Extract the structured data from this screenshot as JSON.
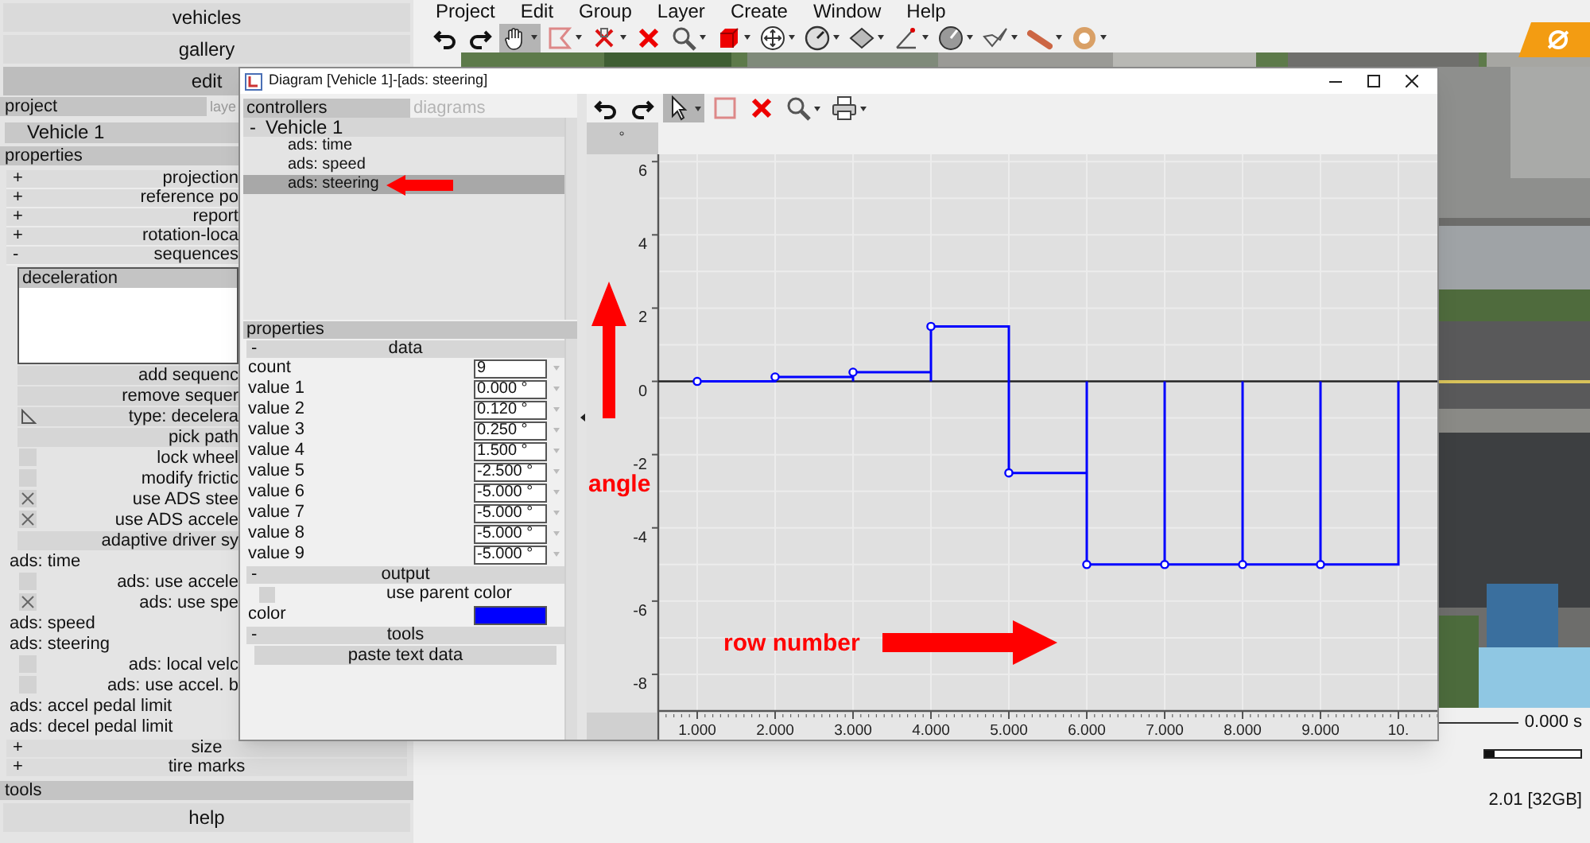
{
  "nav": [
    {
      "label": "vehicles",
      "selected": false
    },
    {
      "label": "gallery",
      "selected": false
    },
    {
      "label": "edit",
      "selected": true
    }
  ],
  "panel_tabs": [
    {
      "label": "project",
      "selected": true
    },
    {
      "label": "laye",
      "selected": false
    }
  ],
  "vehicle_list": [
    {
      "label": "Vehicle 1",
      "selected": true
    }
  ],
  "properties": {
    "title": "properties",
    "rows": [
      {
        "kind": "section",
        "toggle": "+",
        "label": "projection"
      },
      {
        "kind": "section",
        "toggle": "+",
        "label": "reference po"
      },
      {
        "kind": "section",
        "toggle": "+",
        "label": "report"
      },
      {
        "kind": "section",
        "toggle": "+",
        "label": "rotation-loca"
      },
      {
        "kind": "section",
        "toggle": "-",
        "label": "sequences"
      },
      {
        "kind": "list",
        "label": "deceleration"
      },
      {
        "kind": "button",
        "label": "add sequenc"
      },
      {
        "kind": "button",
        "label": "remove sequer"
      },
      {
        "kind": "icon-button",
        "label": "type: decelera"
      },
      {
        "kind": "button",
        "label": "pick path"
      },
      {
        "kind": "checkbox",
        "label": "lock wheel",
        "checked": false
      },
      {
        "kind": "checkbox",
        "label": "modify frictic",
        "checked": false
      },
      {
        "kind": "checkbox",
        "label": "use ADS stee",
        "checked": true
      },
      {
        "kind": "checkbox",
        "label": "use ADS accele",
        "checked": true
      },
      {
        "kind": "button",
        "label": "adaptive driver sy"
      },
      {
        "kind": "label",
        "label": "ads: time"
      },
      {
        "kind": "checkbox",
        "label": "ads: use accele",
        "checked": false
      },
      {
        "kind": "checkbox",
        "label": "ads: use spe",
        "checked": true
      },
      {
        "kind": "label",
        "label": "ads: speed"
      },
      {
        "kind": "label",
        "label": "ads: steering"
      },
      {
        "kind": "checkbox",
        "label": "ads: local velc",
        "checked": false
      },
      {
        "kind": "checkbox",
        "label": "ads: use accel. b",
        "checked": false
      },
      {
        "kind": "label",
        "label": "ads: accel pedal limit"
      },
      {
        "kind": "label",
        "label": "ads: decel pedal limit"
      }
    ],
    "more_rows": [
      {
        "toggle": "+",
        "label": "size"
      },
      {
        "toggle": "+",
        "label": "tire marks"
      }
    ]
  },
  "tools": {
    "title": "tools",
    "button": "help"
  },
  "menu": [
    "Project",
    "Edit",
    "Group",
    "Layer",
    "Create",
    "Window",
    "Help"
  ],
  "main_toolbar": [
    {
      "kind": "undo",
      "selected": false,
      "dropdown": false
    },
    {
      "kind": "redo",
      "selected": false,
      "dropdown": false
    },
    {
      "kind": "hand",
      "selected": true,
      "dropdown": true
    },
    {
      "kind": "select-shape",
      "selected": false,
      "dropdown": true
    },
    {
      "kind": "cut-x",
      "selected": false,
      "dropdown": true
    },
    {
      "kind": "delete",
      "selected": false,
      "dropdown": false
    },
    {
      "kind": "zoom",
      "selected": false,
      "dropdown": true
    },
    {
      "kind": "cube",
      "selected": false,
      "dropdown": true
    },
    {
      "kind": "move",
      "selected": false,
      "dropdown": true
    },
    {
      "kind": "gauge",
      "selected": false,
      "dropdown": true
    },
    {
      "kind": "plate",
      "selected": false,
      "dropdown": true
    },
    {
      "kind": "angle",
      "selected": false,
      "dropdown": true
    },
    {
      "kind": "dial",
      "selected": false,
      "dropdown": true
    },
    {
      "kind": "check",
      "selected": false,
      "dropdown": true
    },
    {
      "kind": "stick",
      "selected": false,
      "dropdown": true
    },
    {
      "kind": "orb",
      "selected": false,
      "dropdown": true
    }
  ],
  "status": {
    "time": "0.000 s",
    "timeline": {
      "level": 0
    },
    "version": "2.01 [32GB]"
  },
  "dialog": {
    "title": "Diagram [Vehicle 1]-[ads: steering]",
    "tabs": [
      {
        "label": "controllers",
        "selected": true
      },
      {
        "label": "diagrams",
        "selected": false
      }
    ],
    "tree": [
      {
        "toggle": "-",
        "label": "Vehicle 1",
        "selected": false,
        "children": [
          {
            "label": "ads: time",
            "selected": false
          },
          {
            "label": "ads: speed",
            "selected": false
          },
          {
            "label": "ads: steering",
            "selected": true
          }
        ]
      }
    ],
    "properties": {
      "title": "properties",
      "sections": [
        {
          "toggle": "-",
          "title": "data",
          "rows": [
            {
              "kind": "field",
              "label": "count",
              "value": "9"
            },
            {
              "kind": "field",
              "label": "value 1",
              "value": "0.000 °"
            },
            {
              "kind": "field",
              "label": "value 2",
              "value": "0.120 °"
            },
            {
              "kind": "field",
              "label": "value 3",
              "value": "0.250 °"
            },
            {
              "kind": "field",
              "label": "value 4",
              "value": "1.500 °"
            },
            {
              "kind": "field",
              "label": "value 5",
              "value": "-2.500 °"
            },
            {
              "kind": "field",
              "label": "value 6",
              "value": "-5.000 °"
            },
            {
              "kind": "field",
              "label": "value 7",
              "value": "-5.000 °"
            },
            {
              "kind": "field",
              "label": "value 8",
              "value": "-5.000 °"
            },
            {
              "kind": "field",
              "label": "value 9",
              "value": "-5.000 °"
            }
          ]
        },
        {
          "toggle": "-",
          "title": "output",
          "rows": [
            {
              "kind": "checkbox",
              "label": "use parent color",
              "checked": false
            },
            {
              "kind": "color",
              "label": "color",
              "color": "#0000ff"
            }
          ]
        },
        {
          "toggle": "-",
          "title": "tools",
          "rows": [
            {
              "kind": "button",
              "label": "paste text data"
            }
          ]
        }
      ]
    },
    "toolbar": [
      {
        "kind": "undo",
        "selected": false,
        "dropdown": false
      },
      {
        "kind": "redo",
        "selected": false,
        "dropdown": false
      },
      {
        "kind": "pointer",
        "selected": true,
        "dropdown": true
      },
      {
        "kind": "rect",
        "selected": false,
        "dropdown": false
      },
      {
        "kind": "delete",
        "selected": false,
        "dropdown": false
      },
      {
        "kind": "zoom",
        "selected": false,
        "dropdown": true
      },
      {
        "kind": "print",
        "selected": false,
        "dropdown": true
      }
    ],
    "y_unit": "°",
    "chart_data": {
      "type": "line",
      "x": [
        1,
        2,
        2,
        3,
        3,
        3,
        4,
        4,
        4,
        5,
        5,
        5,
        6,
        6,
        6,
        7,
        7,
        7,
        8,
        8,
        8,
        9,
        9,
        9,
        10,
        10
      ],
      "series": [
        {
          "color": "#0000ff",
          "values": [
            0,
            0,
            0.12,
            0.12,
            0,
            0.25,
            0.25,
            0,
            1.5,
            1.5,
            0,
            -2.5,
            -2.5,
            0,
            -5,
            -5,
            0,
            -5,
            -5,
            0,
            -5,
            -5,
            0,
            -5,
            -5,
            0
          ]
        }
      ],
      "xlim": [
        0.5,
        10.5
      ],
      "ylim": [
        -9,
        6.2
      ],
      "xticks": [
        {
          "value": 1,
          "label": "1.000"
        },
        {
          "value": 2,
          "label": "2.000"
        },
        {
          "value": 3,
          "label": "3.000"
        },
        {
          "value": 4,
          "label": "4.000"
        },
        {
          "value": 5,
          "label": "5.000"
        },
        {
          "value": 6,
          "label": "6.000"
        },
        {
          "value": 7,
          "label": "7.000"
        },
        {
          "value": 8,
          "label": "8.000"
        },
        {
          "value": 9,
          "label": "9.000"
        },
        {
          "value": 10,
          "label": "10."
        }
      ],
      "yticks": [
        -8,
        -6,
        -4,
        -2,
        0,
        2,
        4,
        6
      ],
      "grid": true
    }
  },
  "callouts": [
    {
      "kind": "arrow-left"
    },
    {
      "kind": "arrow-up"
    },
    {
      "kind": "label",
      "text": "angle"
    },
    {
      "kind": "label",
      "text": "row number"
    },
    {
      "kind": "arrow-right"
    }
  ]
}
